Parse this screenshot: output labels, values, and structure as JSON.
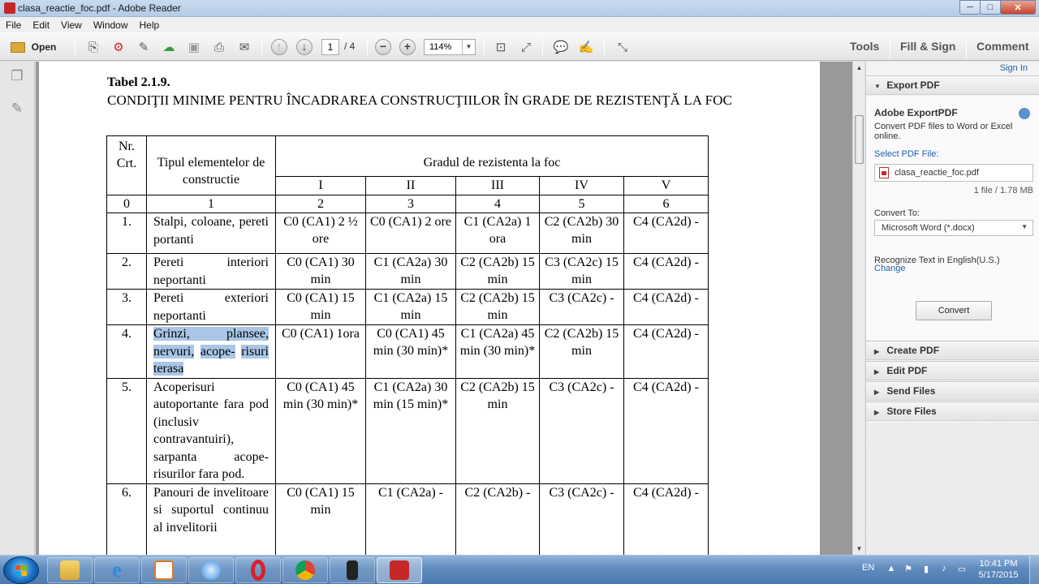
{
  "window": {
    "title": "clasa_reactie_foc.pdf - Adobe Reader",
    "minimize": "─",
    "maximize": "□",
    "close": "✕"
  },
  "menu": [
    "File",
    "Edit",
    "View",
    "Window",
    "Help"
  ],
  "toolbar": {
    "open_label": "Open",
    "page_current": "1",
    "page_total": "/ 4",
    "zoom": "114%",
    "tools": "Tools",
    "fill_sign": "Fill & Sign",
    "comment": "Comment"
  },
  "document": {
    "table_title": "Tabel 2.1.9.",
    "table_subtitle": "CONDIŢII MINIME PENTRU ÎNCADRAREA CONSTRUCŢIILOR ÎN GRADE DE REZISTENŢĂ LA  FOC",
    "header": {
      "nr": "Nr. Crt.",
      "tip": "Tipul elementelor de constructie",
      "grad": "Gradul de rezistenta la foc",
      "grades": [
        "I",
        "II",
        "III",
        "IV",
        "V"
      ],
      "index": [
        "0",
        "1",
        "2",
        "3",
        "4",
        "5",
        "6"
      ]
    },
    "rows": [
      {
        "nr": "1.",
        "element": "Stalpi, coloane, pereti portanti",
        "values": [
          "C0 (CA1) 2 ½ ore",
          "C0 (CA1) 2 ore",
          "C1 (CA2a) 1 ora",
          "C2 (CA2b) 30 min",
          "C4 (CA2d) -"
        ]
      },
      {
        "nr": "2.",
        "element": "Pereti interiori neportanti",
        "values": [
          "C0 (CA1) 30 min",
          "C1 (CA2a) 30 min",
          "C2 (CA2b) 15 min",
          "C3 (CA2c) 15 min",
          "C4 (CA2d) -"
        ]
      },
      {
        "nr": "3.",
        "element": "Pereti exteriori neportanti",
        "values": [
          "C0 (CA1) 15 min",
          "C1 (CA2a) 15 min",
          "C2 (CA2b) 15 min",
          "C3 (CA2c) -",
          "C4 (CA2d) -"
        ]
      },
      {
        "nr": "4.",
        "element_parts": [
          "Grinzi, plansee, nervuri,",
          "acope-",
          "risuri terasa"
        ],
        "values": [
          "C0 (CA1) 1ora",
          "C0 (CA1) 45 min (30 min)*",
          "C1 (CA2a) 45 min (30 min)*",
          "C2 (CA2b) 15 min",
          "C4 (CA2d) -"
        ]
      },
      {
        "nr": "5.",
        "element": "Acoperisuri autoportante fara pod (inclusiv contravantuiri), sarpanta acope-risurilor fara pod.",
        "values": [
          "C0 (CA1) 45 min (30 min)*",
          "C1 (CA2a) 30 min (15 min)*",
          "C2 (CA2b) 15 min",
          "C3 (CA2c) -",
          "C4 (CA2d) -"
        ]
      },
      {
        "nr": "6.",
        "element": "Panouri de invelitoare si suportul continuu al invelitorii",
        "values": [
          "C0 (CA1) 15 min",
          "C1 (CA2a) -",
          "C2 (CA2b) -",
          "C3 (CA2c) -",
          "C4 (CA2d) -"
        ]
      }
    ]
  },
  "right_panel": {
    "sign_in": "Sign In",
    "export_pdf": "Export PDF",
    "adobe_exportpdf": "Adobe ExportPDF",
    "description": "Convert PDF files to Word or Excel online.",
    "select_label": "Select PDF File:",
    "file_name": "clasa_reactie_foc.pdf",
    "file_info": "1 file / 1.78 MB",
    "convert_to_label": "Convert To:",
    "convert_to_value": "Microsoft Word (*.docx)",
    "recognize": "Recognize Text in English(U.S.)",
    "change": "Change",
    "convert_button": "Convert",
    "sections": [
      "Create PDF",
      "Edit PDF",
      "Send Files",
      "Store Files"
    ]
  },
  "taskbar": {
    "lang": "EN",
    "time": "10:41 PM",
    "date": "5/17/2015"
  },
  "colors": {
    "accent": "#1f5fa8",
    "highlight": "#a9c6e6",
    "pdf_red": "#c62828"
  }
}
